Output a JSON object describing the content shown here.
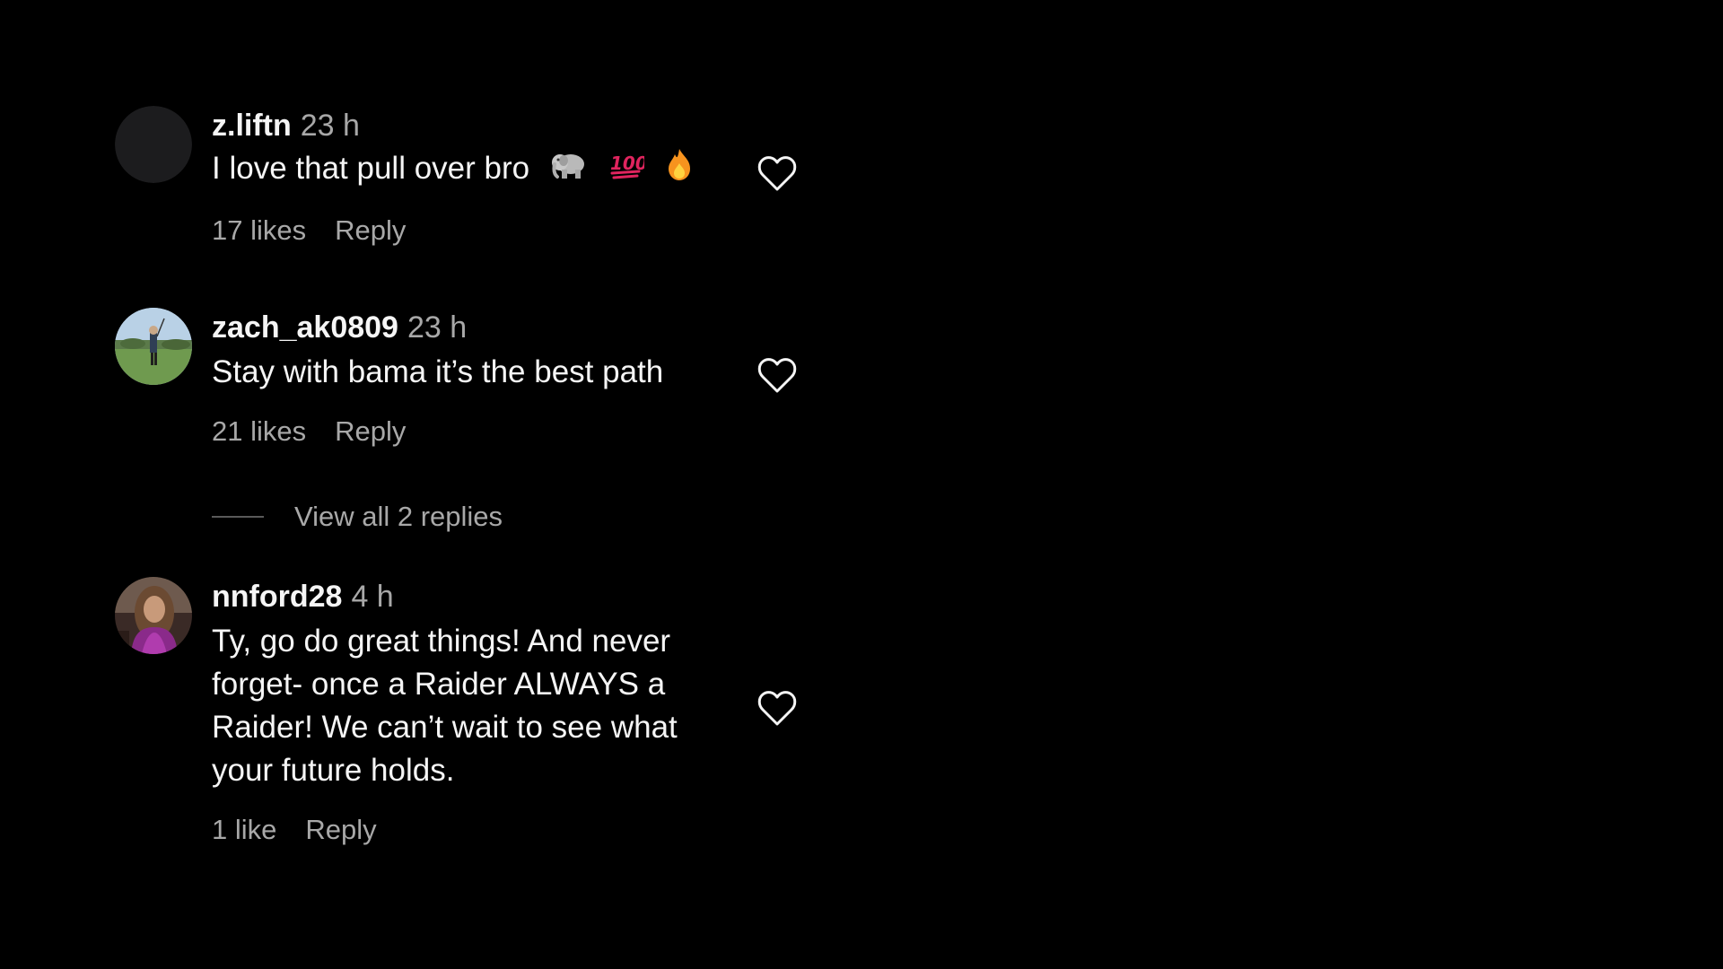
{
  "comments": [
    {
      "username": "z.liftn",
      "time": "23 h",
      "text": "I love that pull over bro",
      "emojis": [
        "elephant",
        "hundred-points",
        "fire"
      ],
      "likes": "17 likes",
      "reply_label": "Reply"
    },
    {
      "username": "zach_ak0809",
      "time": "23 h",
      "text": "Stay with bama it’s the best path",
      "likes": "21 likes",
      "reply_label": "Reply",
      "view_replies": "View all 2 replies"
    },
    {
      "username": "nnford28",
      "time": "4 h",
      "text_lines": [
        "Ty, go do great things! And never",
        "forget- once a Raider ALWAYS a",
        "Raider! We can’t wait to see what",
        "your future holds."
      ],
      "likes": "1 like",
      "reply_label": "Reply"
    }
  ],
  "icons": {
    "like": "heart-outline-icon"
  },
  "colors": {
    "background": "#000000",
    "primary_text": "#f5f5f5",
    "secondary_text": "#a8a8a8"
  }
}
